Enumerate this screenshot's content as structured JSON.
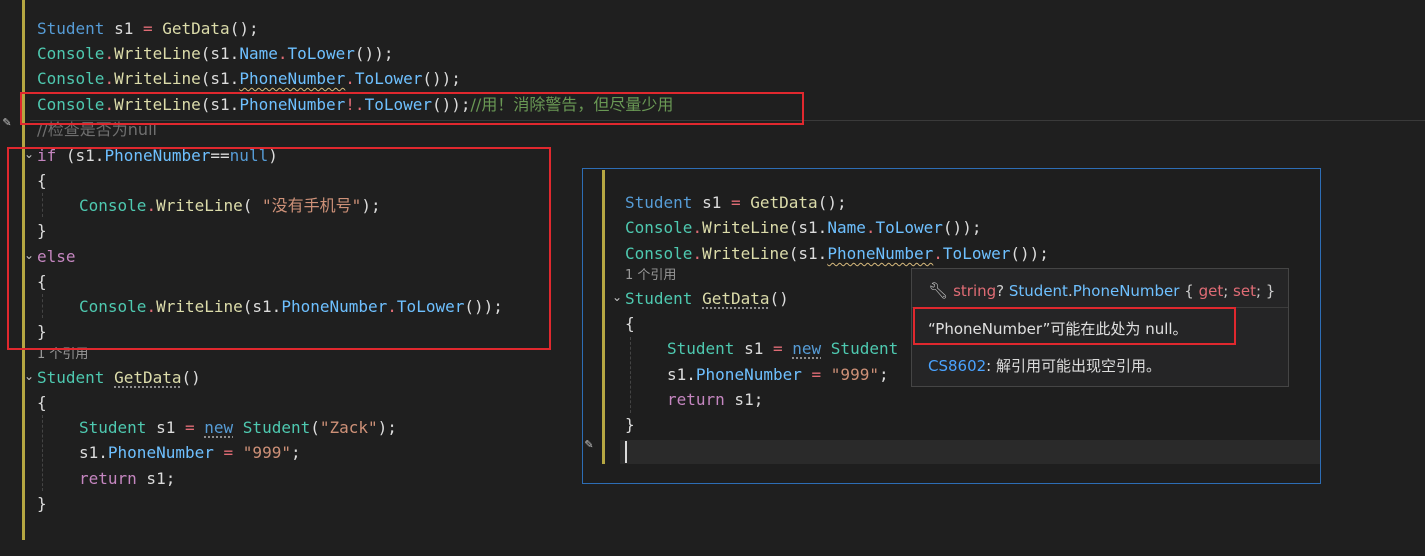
{
  "main": {
    "line1": {
      "t1": "Student",
      "t2": " s1 ",
      "t3": "=",
      "t4": " ",
      "t5": "GetData",
      "t6": "();"
    },
    "line2": {
      "t1": "Console",
      "t2": ".",
      "t3": "WriteLine",
      "t4": "(s1.",
      "t5": "Name",
      "t6": ".",
      "t7": "ToLower",
      "t8": "());"
    },
    "line3": {
      "t1": "Console",
      "t2": ".",
      "t3": "WriteLine",
      "t4": "(s1.",
      "t5": "PhoneNumber",
      "t6": ".",
      "t7": "ToLower",
      "t8": "());"
    },
    "line4": {
      "t1": "Console",
      "t2": ".",
      "t3": "WriteLine",
      "t4": "(s1.",
      "t5": "PhoneNumber",
      "t6": "!",
      "t7": ".",
      "t8": "ToLower",
      "t9": "());",
      "comment": "//用！消除警告，但尽量少用"
    },
    "line5": {
      "comment": "//检查是否为null"
    },
    "line6": {
      "t1": "if",
      "t2": " (s1.",
      "t3": "PhoneNumber",
      "t4": "==",
      "t5": "null",
      "t6": ")"
    },
    "line7": "{",
    "line8": {
      "t1": "Console",
      "t2": ".",
      "t3": "WriteLine",
      "t4": "( ",
      "t5": "\"没有手机号\"",
      "t6": ");"
    },
    "line9": "}",
    "line10": "else",
    "line11": "{",
    "line12": {
      "t1": "Console",
      "t2": ".",
      "t3": "WriteLine",
      "t4": "(s1.",
      "t5": "PhoneNumber",
      "t6": ".",
      "t7": "ToLower",
      "t8": "());"
    },
    "line13": "}",
    "codelens": "1 个引用",
    "line15": {
      "t1": "Student",
      "t2": " ",
      "t3": "GetData",
      "t4": "()"
    },
    "line16": "{",
    "line17": {
      "t1": "Student",
      "t2": " s1 ",
      "t3": "=",
      "t4": " ",
      "t5": "new",
      "t6": " ",
      "t7": "Student",
      "t8": "(",
      "t9": "\"Zack\"",
      "t10": ");"
    },
    "line18": {
      "t1": "s1.",
      "t2": "PhoneNumber",
      "t3": " ",
      "t4": "=",
      "t5": " ",
      "t6": "\"999\"",
      "t7": ";"
    },
    "line19": {
      "t1": "return",
      "t2": " s1;"
    },
    "line20": "}"
  },
  "peek": {
    "line1": {
      "t1": "Student",
      "t2": " s1 ",
      "t3": "=",
      "t4": " ",
      "t5": "GetData",
      "t6": "();"
    },
    "line2": {
      "t1": "Console",
      "t2": ".",
      "t3": "WriteLine",
      "t4": "(s1.",
      "t5": "Name",
      "t6": ".",
      "t7": "ToLower",
      "t8": "());"
    },
    "line3": {
      "t1": "Console",
      "t2": ".",
      "t3": "WriteLine",
      "t4": "(s1.",
      "t5": "PhoneNumber",
      "t6": ".",
      "t7": "ToLower",
      "t8": "());"
    },
    "codelens": "1 个引用",
    "line5": {
      "t1": "Student",
      "t2": " ",
      "t3": "GetData",
      "t4": "()"
    },
    "line6": "{",
    "line7": {
      "t1": "Student",
      "t2": " s1 ",
      "t3": "=",
      "t4": " ",
      "t5": "new",
      "t6": " ",
      "t7": "Student"
    },
    "line8": {
      "t1": "s1.",
      "t2": "PhoneNumber",
      "t3": " ",
      "t4": "=",
      "t5": " ",
      "t6": "\"999\"",
      "t7": ";"
    },
    "line9": {
      "t1": "return",
      "t2": " s1;"
    },
    "line10": "}"
  },
  "tooltip": {
    "icon": "wrench-icon",
    "sig": {
      "type": "string",
      "q": "? ",
      "cls": "Student",
      "dot": ".",
      "prop": "PhoneNumber",
      "b1": " { ",
      "get": "get",
      "semi1": "; ",
      "set": "set",
      "semi2": "; }"
    },
    "message": "“PhoneNumber”可能在此处为 null。",
    "code": "CS8602",
    "code_desc": ": 解引用可能出现空引用。"
  },
  "colors": {
    "background": "#1f1f1f",
    "highlight_box": "#e0282e",
    "peek_border": "#2d6db5"
  }
}
